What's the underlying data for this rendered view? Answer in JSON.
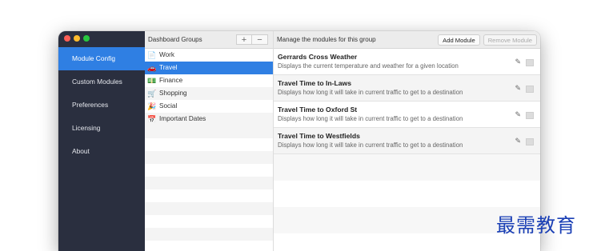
{
  "window": {
    "traffic_lights": {
      "close_color": "#fe5f57",
      "minimize_color": "#febc2e",
      "zoom_color": "#28c840"
    }
  },
  "sidebar": {
    "items": [
      {
        "label": "Module Config",
        "active": true
      },
      {
        "label": "Custom Modules",
        "active": false
      },
      {
        "label": "Preferences",
        "active": false
      },
      {
        "label": "Licensing",
        "active": false
      },
      {
        "label": "About",
        "active": false
      }
    ],
    "accent_color": "#2f7fe3",
    "background_color": "#2a2f3f"
  },
  "groups": {
    "header": "Dashboard Groups",
    "add_label": "+",
    "remove_label": "−",
    "items": [
      {
        "label": "Work",
        "icon": "📄",
        "icon_name": "document-icon",
        "selected": false
      },
      {
        "label": "Travel",
        "icon": "🚗",
        "icon_name": "car-icon",
        "selected": true
      },
      {
        "label": "Finance",
        "icon": "💵",
        "icon_name": "money-icon",
        "selected": false
      },
      {
        "label": "Shopping",
        "icon": "🛒",
        "icon_name": "cart-icon",
        "selected": false
      },
      {
        "label": "Social",
        "icon": "🎉",
        "icon_name": "party-icon",
        "selected": false
      },
      {
        "label": "Important Dates",
        "icon": "📅",
        "icon_name": "calendar-icon",
        "selected": false
      }
    ]
  },
  "modules": {
    "header": "Manage the modules for this group",
    "add_button": "Add Module",
    "remove_button": "Remove Module",
    "items": [
      {
        "title": "Gerrards Cross Weather",
        "description": "Displays the current temperature and weather for a given location"
      },
      {
        "title": "Travel Time to In-Laws",
        "description": "Displays how long it will take in current traffic to get to a destination"
      },
      {
        "title": "Travel Time to Oxford St",
        "description": "Displays how long it will take in current traffic to get to a destination"
      },
      {
        "title": "Travel Time to Westfields",
        "description": "Displays how long it will take in current traffic to get to a destination"
      }
    ],
    "edit_icon": "✎"
  },
  "watermark": "最需教育"
}
